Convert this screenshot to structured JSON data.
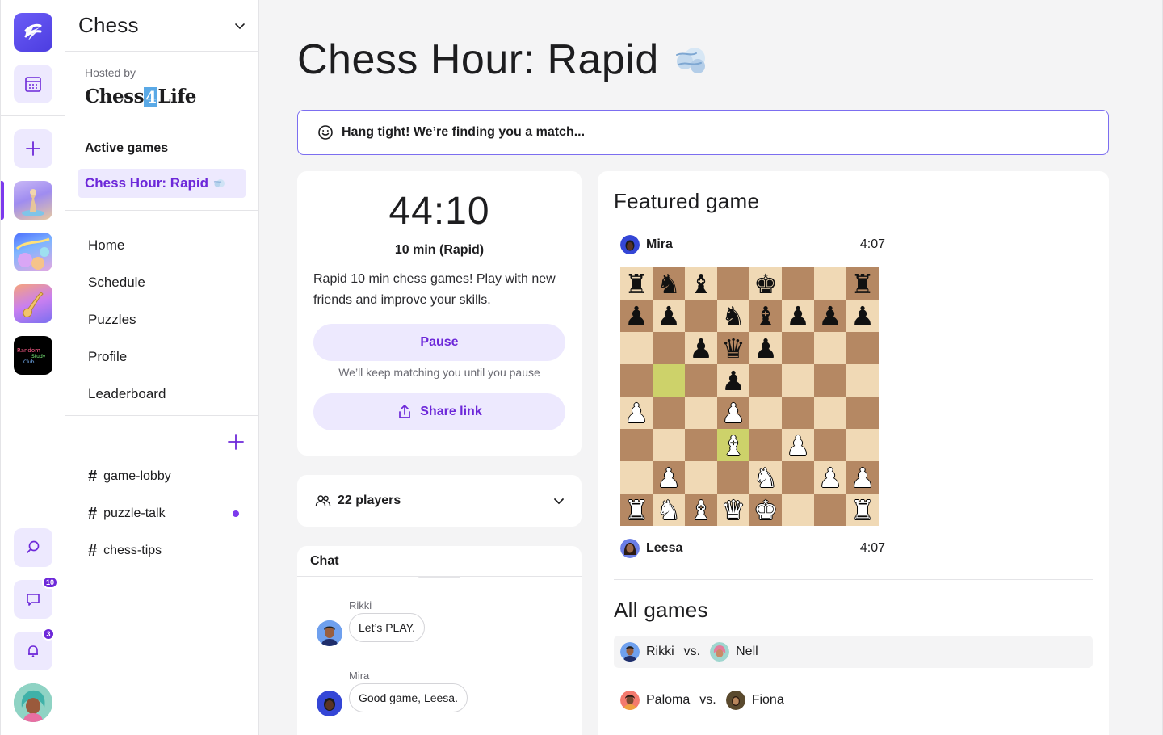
{
  "rail": {
    "notifications_badge": "3",
    "messages_badge": "10"
  },
  "sidebar": {
    "community_name": "Chess",
    "hosted_by_label": "Hosted by",
    "host_name_part1": "Chess",
    "host_name_part2": "4",
    "host_name_part3": "Life",
    "active_games_label": "Active games",
    "active_game": "Chess Hour: Rapid",
    "nav": [
      "Home",
      "Schedule",
      "Puzzles",
      "Profile",
      "Leaderboard"
    ],
    "channels": [
      {
        "name": "game-lobby",
        "unread": false
      },
      {
        "name": "puzzle-talk",
        "unread": true
      },
      {
        "name": "chess-tips",
        "unread": false
      }
    ]
  },
  "main": {
    "title": "Chess Hour: Rapid",
    "banner": "Hang tight! We’re finding you a match...",
    "timer": "44:10",
    "mode": "10 min (Rapid)",
    "description": "Rapid 10 min chess games! Play with new friends and improve your skills.",
    "pause_label": "Pause",
    "pause_hint": "We’ll keep matching you until you pause",
    "share_label": "Share link",
    "players_label": "22 players",
    "chat_label": "Chat",
    "messages": [
      {
        "author": "Rikki",
        "text": "Let’s PLAY."
      },
      {
        "author": "Mira",
        "text": "Good game, Leesa."
      }
    ]
  },
  "featured": {
    "title": "Featured game",
    "top_player": "Mira",
    "top_clock": "4:07",
    "bottom_player": "Leesa",
    "bottom_clock": "4:07",
    "board": [
      [
        "br",
        "bn",
        "bb",
        "",
        "bk",
        "",
        "",
        "br"
      ],
      [
        "bp",
        "bp",
        "",
        "bn",
        "bb",
        "bp",
        "bp",
        "bp"
      ],
      [
        "",
        "",
        "bp",
        "bq",
        "bp",
        "",
        "",
        ""
      ],
      [
        "",
        "",
        "",
        "bp",
        "",
        "",
        "",
        ""
      ],
      [
        "wp",
        "",
        "",
        "wp",
        "",
        "",
        "",
        ""
      ],
      [
        "",
        "",
        "",
        "wb",
        "",
        "wp",
        "",
        ""
      ],
      [
        "",
        "wp",
        "",
        "",
        "wn",
        "",
        "wp",
        "wp"
      ],
      [
        "wr",
        "wn",
        "wb",
        "wq",
        "wk",
        "",
        "",
        "wr"
      ]
    ],
    "highlight_squares": [
      "d3",
      "b5"
    ]
  },
  "all_games": {
    "title": "All games",
    "vs_label": "vs.",
    "games": [
      {
        "white": "Rikki",
        "black": "Nell"
      },
      {
        "white": "Paloma",
        "black": "Fiona"
      }
    ]
  },
  "colors": {
    "accent": "#6d28d9",
    "accent_soft": "#ede9fe",
    "board_light": "#f0d9b5",
    "board_dark": "#b58863",
    "highlight": "#cdd26a"
  }
}
